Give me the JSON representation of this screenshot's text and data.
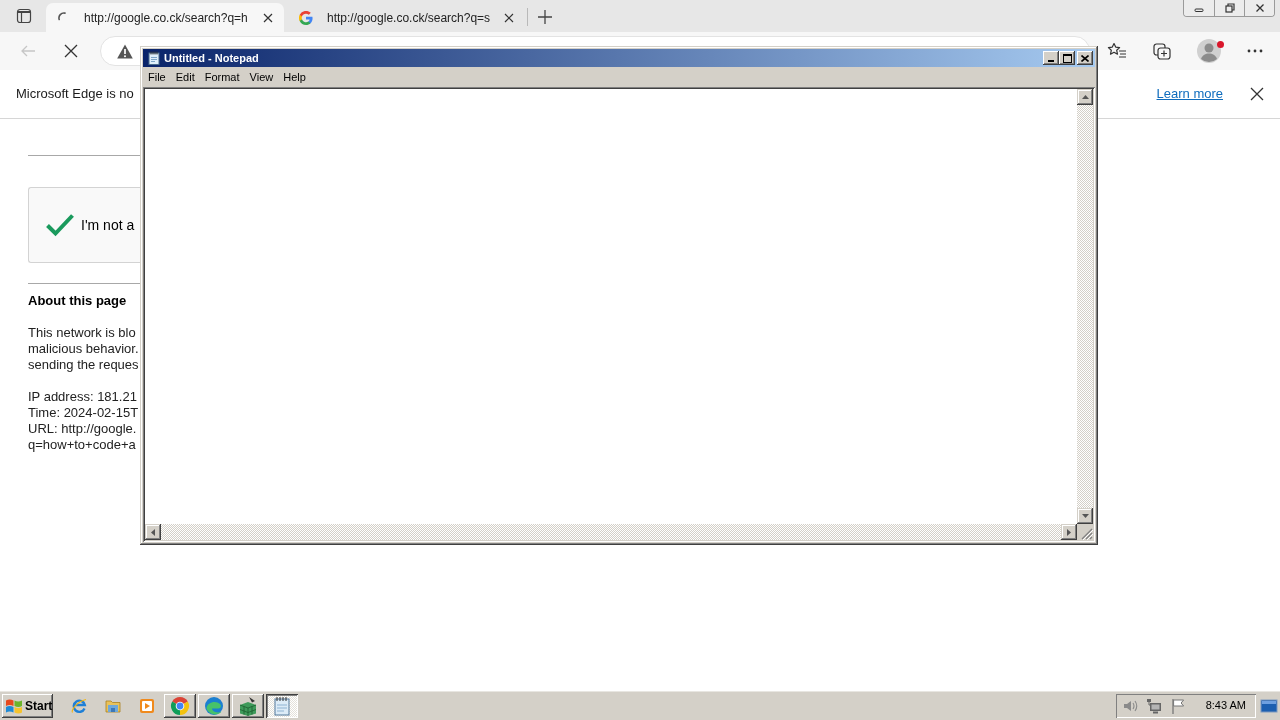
{
  "browser": {
    "tabs": [
      {
        "title": "http://google.co.ck/search?q=h",
        "selected": true,
        "loading": true
      },
      {
        "title": "http://google.co.ck/search?q=s",
        "selected": false,
        "loading": false
      }
    ],
    "back": {
      "disabled": true
    },
    "profile": {
      "notification": true
    },
    "info_bar": {
      "message": "Microsoft Edge is no",
      "link": "Learn more"
    }
  },
  "page": {
    "captcha": {
      "label": "I'm not a",
      "checked": true
    },
    "heading": "About this page",
    "paragraph": [
      "This network is blo",
      "malicious behavior.",
      "sending the reques"
    ],
    "details": [
      "IP address: 181.21",
      "Time: 2024-02-15T",
      "URL: http://google.",
      "q=how+to+code+a"
    ]
  },
  "notepad": {
    "title": "Untitled - Notepad",
    "menu": [
      "File",
      "Edit",
      "Format",
      "View",
      "Help"
    ]
  },
  "taskbar": {
    "start": "Start",
    "tasks": [
      {
        "selected": false
      },
      {
        "selected": false
      },
      {
        "selected": false
      },
      {
        "selected": true
      }
    ],
    "clock": "8:43 AM"
  }
}
